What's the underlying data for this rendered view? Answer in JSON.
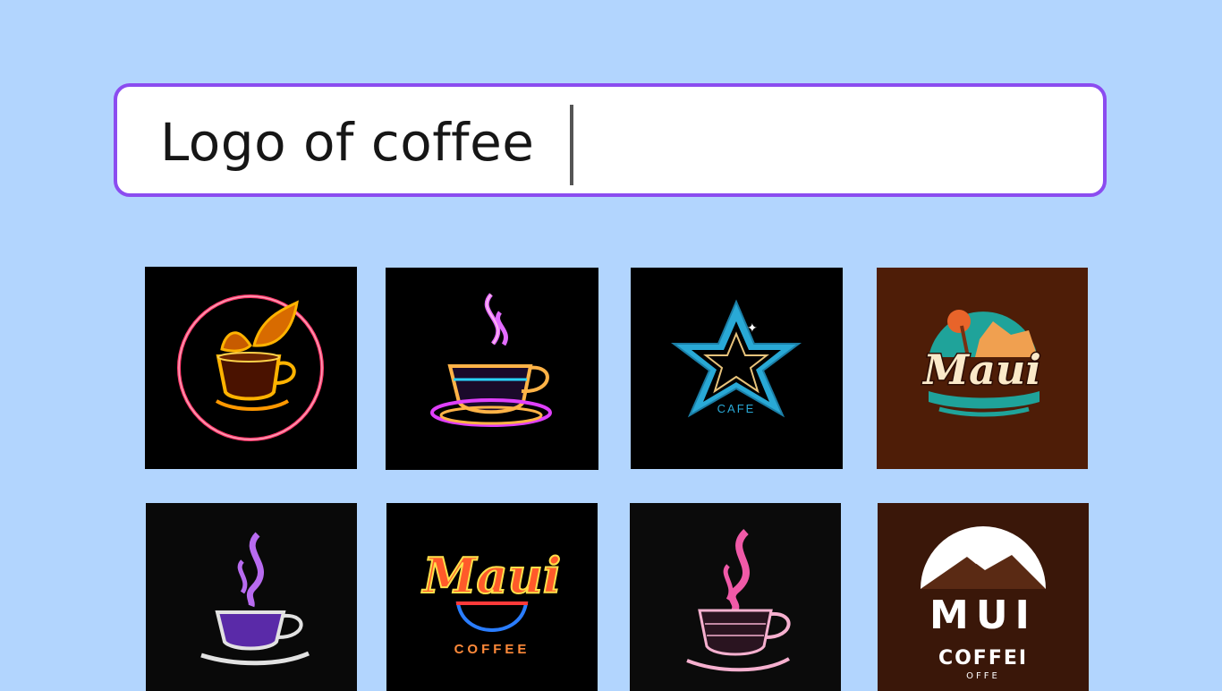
{
  "search": {
    "query": "Logo of coffee"
  },
  "results": [
    {
      "name": "neon-leaf-cup-logo"
    },
    {
      "name": "neon-steaming-cup-logo"
    },
    {
      "name": "star-cafe-logo",
      "text": "CAFE"
    },
    {
      "name": "maui-tropical-logo",
      "text": "Maui"
    },
    {
      "name": "purple-steam-cup-logo"
    },
    {
      "name": "maui-neon-coffee-logo",
      "text": "Maui",
      "subtext": "COFFEE"
    },
    {
      "name": "pink-steam-cup-logo"
    },
    {
      "name": "maui-mountain-coffee-logo",
      "text": "MUI",
      "subtext": "COFFEI",
      "subtext2": "OFFE"
    }
  ],
  "colors": {
    "background": "#b2d5fe",
    "search_border": "#8b4cf0"
  }
}
